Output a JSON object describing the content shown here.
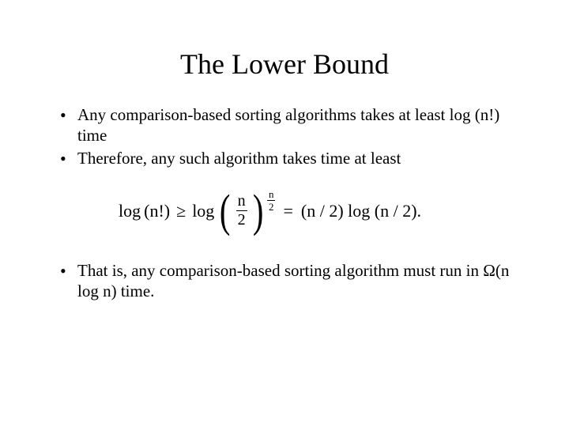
{
  "title": "The Lower Bound",
  "bullets": {
    "b1": "Any comparison-based sorting algorithms takes at least log (n!) time",
    "b2": "Therefore, any such algorithm takes time at least",
    "b3": "That is, any comparison-based sorting algorithm must run in Ω(n log n) time."
  },
  "formula": {
    "lhs_log": "log",
    "lhs_arg": "(n!)",
    "ge": "≥",
    "rhs_log1": "log",
    "lparen": "(",
    "frac_n": "n",
    "frac_2": "2",
    "sup_n": "n",
    "sup_2": "2",
    "rparen": ")",
    "eq": "=",
    "rhs_tail": "(n / 2) log (n / 2)."
  }
}
